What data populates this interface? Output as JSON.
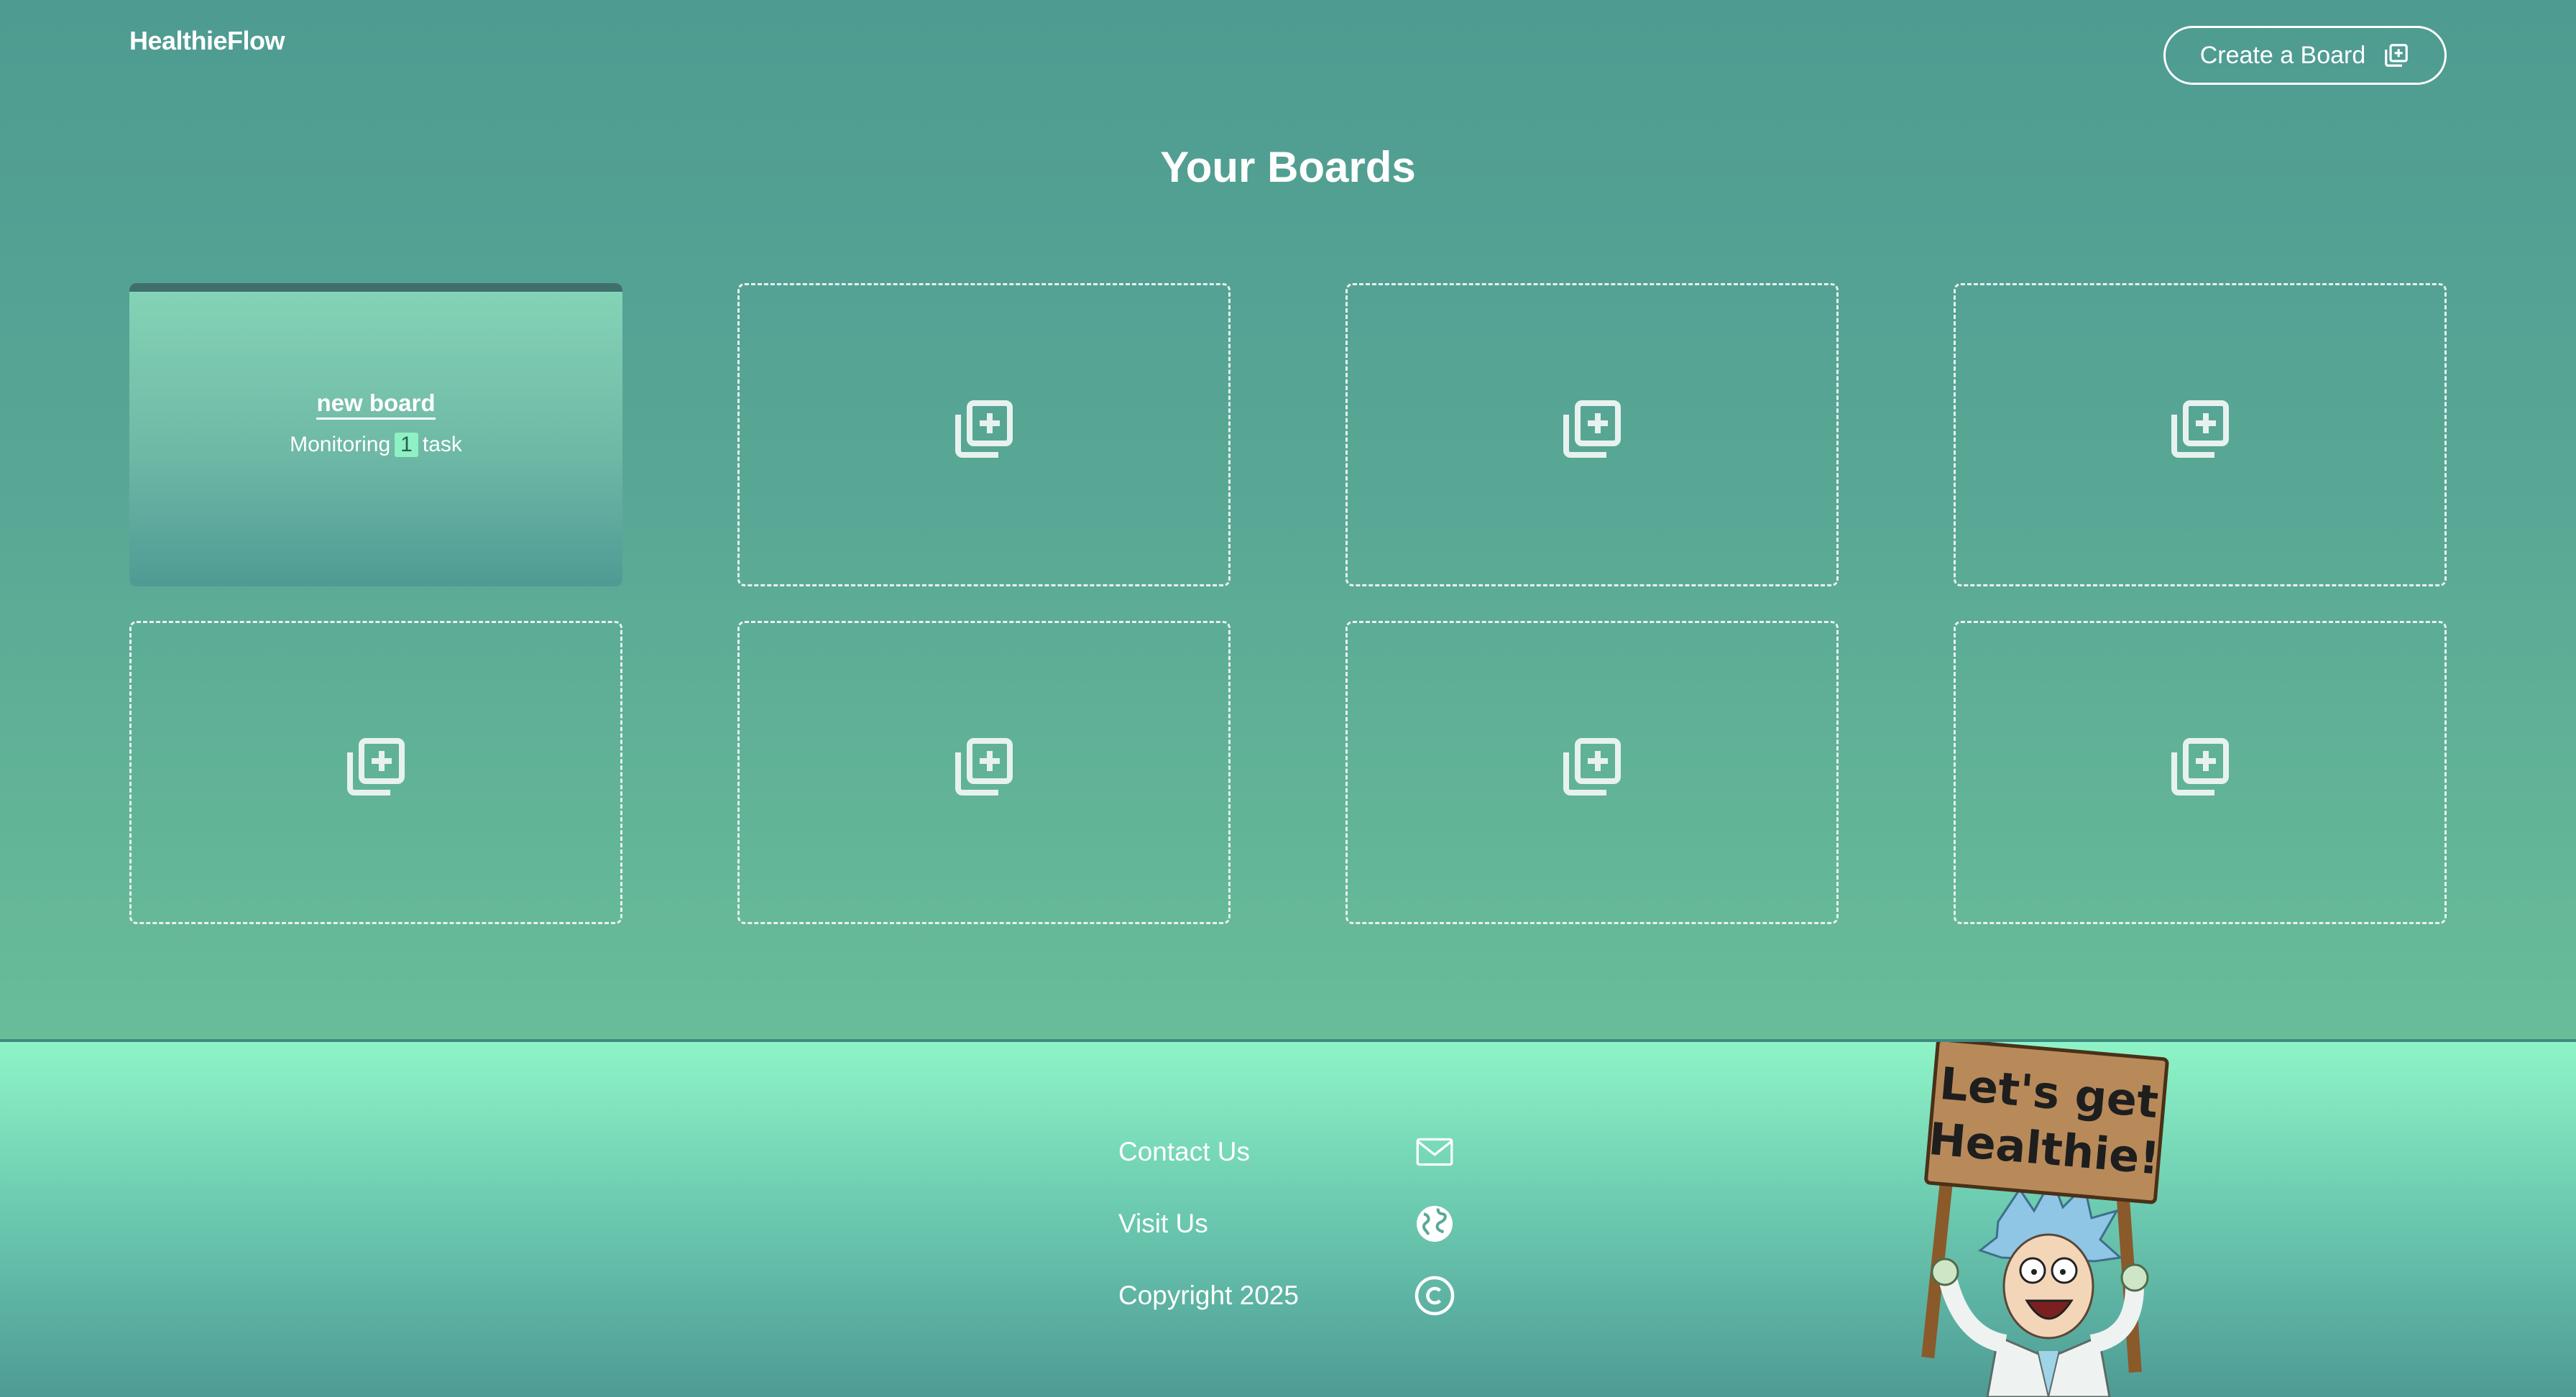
{
  "header": {
    "brand": "HealthieFlow",
    "create_button_label": "Create a Board",
    "create_icon": "add-board-icon"
  },
  "page_title": "Your Boards",
  "boards": [
    {
      "name": "new board",
      "meta_prefix": "Monitoring",
      "count": "1",
      "meta_suffix": "task"
    }
  ],
  "empty_slot_icon": "add-board-icon",
  "empty_slot_count": 7,
  "footer": {
    "contact_label": "Contact Us",
    "contact_icon": "mail-icon",
    "visit_label": "Visit Us",
    "visit_icon": "globe-icon",
    "copyright_label": "Copyright 2025",
    "copyright_icon": "copyright-icon",
    "mascot_sign_text": "Let's get Healthie!"
  },
  "colors": {
    "main_top": "#4e9b91",
    "main_bottom": "#69bd99",
    "footer_top": "#8ef4c7",
    "footer_bottom": "#4e9b95",
    "count_badge": "#8ff0c3",
    "text": "#ffffff"
  }
}
